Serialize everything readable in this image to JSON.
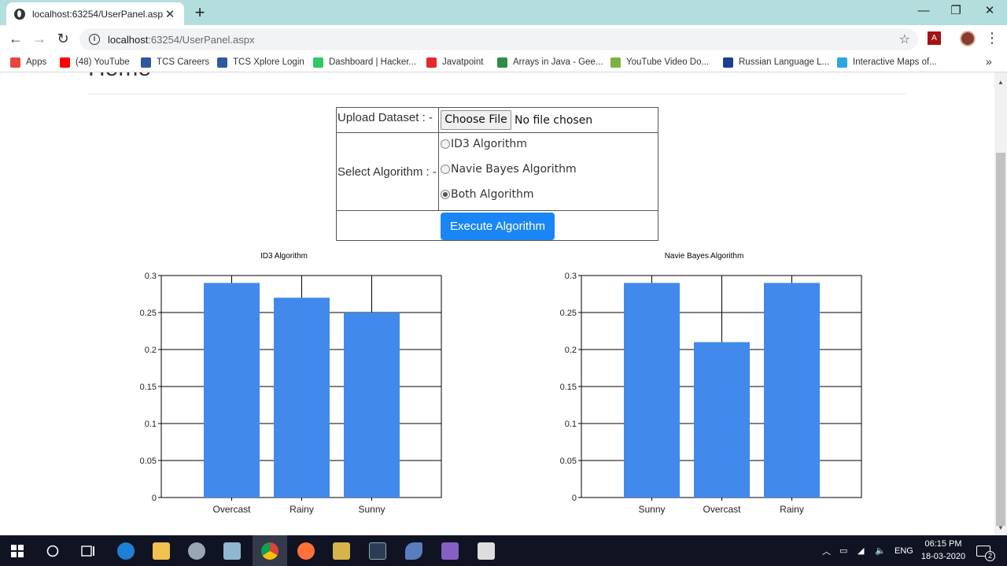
{
  "browser": {
    "tab_title": "localhost:63254/UserPanel.aspx",
    "new_tab": "+",
    "url_host": "localhost",
    "url_path": ":63254/UserPanel.aspx",
    "bookmarks": [
      {
        "label": "Apps",
        "icon": "apps-grid-icon",
        "color": "#e8453c"
      },
      {
        "label": "(48) YouTube",
        "icon": "youtube-icon",
        "color": "#ff0000"
      },
      {
        "label": "TCS Careers",
        "icon": "tata-icon",
        "color": "#2c5aa0"
      },
      {
        "label": "TCS Xplore Login",
        "icon": "tata-icon",
        "color": "#2c5aa0"
      },
      {
        "label": "Dashboard | Hacker...",
        "icon": "hackerrank-icon",
        "color": "#2ec866"
      },
      {
        "label": "Javatpoint",
        "icon": "javatpoint-icon",
        "color": "#e32b2b"
      },
      {
        "label": "Arrays in Java - Gee...",
        "icon": "geeksforgeeks-icon",
        "color": "#2f8d46"
      },
      {
        "label": "YouTube Video Do...",
        "icon": "download-arrow-icon",
        "color": "#7cb342"
      },
      {
        "label": "Russian Language L...",
        "icon": "russia-flag-icon",
        "color": "#1c3f94"
      },
      {
        "label": "Interactive Maps of...",
        "icon": "maps-m-icon",
        "color": "#29a8e0"
      }
    ]
  },
  "page": {
    "heading": "Home",
    "upload_label": "Upload Dataset : -",
    "choose_file": "Choose File",
    "no_file": "No file chosen",
    "algo_label": "Select Algorithm : -",
    "options": [
      {
        "label": "ID3 Algorithm",
        "checked": false
      },
      {
        "label": "Navie Bayes Algorithm",
        "checked": false
      },
      {
        "label": "Both Algorithm",
        "checked": true
      }
    ],
    "execute": "Execute Algorithm"
  },
  "chart_data": [
    {
      "type": "bar",
      "title": "ID3 Algorithm",
      "categories": [
        "Overcast",
        "Rainy",
        "Sunny"
      ],
      "values": [
        0.29,
        0.27,
        0.25
      ],
      "ylim": [
        0,
        0.3
      ],
      "yticks": [
        "0",
        "0.05",
        "0.1",
        "0.15",
        "0.2",
        "0.25",
        "0.3"
      ],
      "grid": true,
      "bar_color": "#4189ea"
    },
    {
      "type": "bar",
      "title": "Navie Bayes Algorithm",
      "categories": [
        "Sunny",
        "Overcast",
        "Rainy"
      ],
      "values": [
        0.29,
        0.21,
        0.29
      ],
      "ylim": [
        0,
        0.3
      ],
      "yticks": [
        "0",
        "0.05",
        "0.1",
        "0.15",
        "0.2",
        "0.25",
        "0.3"
      ],
      "grid": true,
      "bar_color": "#4189ea"
    }
  ],
  "taskbar": {
    "lang": "ENG",
    "time": "06:15 PM",
    "date": "18-03-2020",
    "notifications": "2"
  }
}
